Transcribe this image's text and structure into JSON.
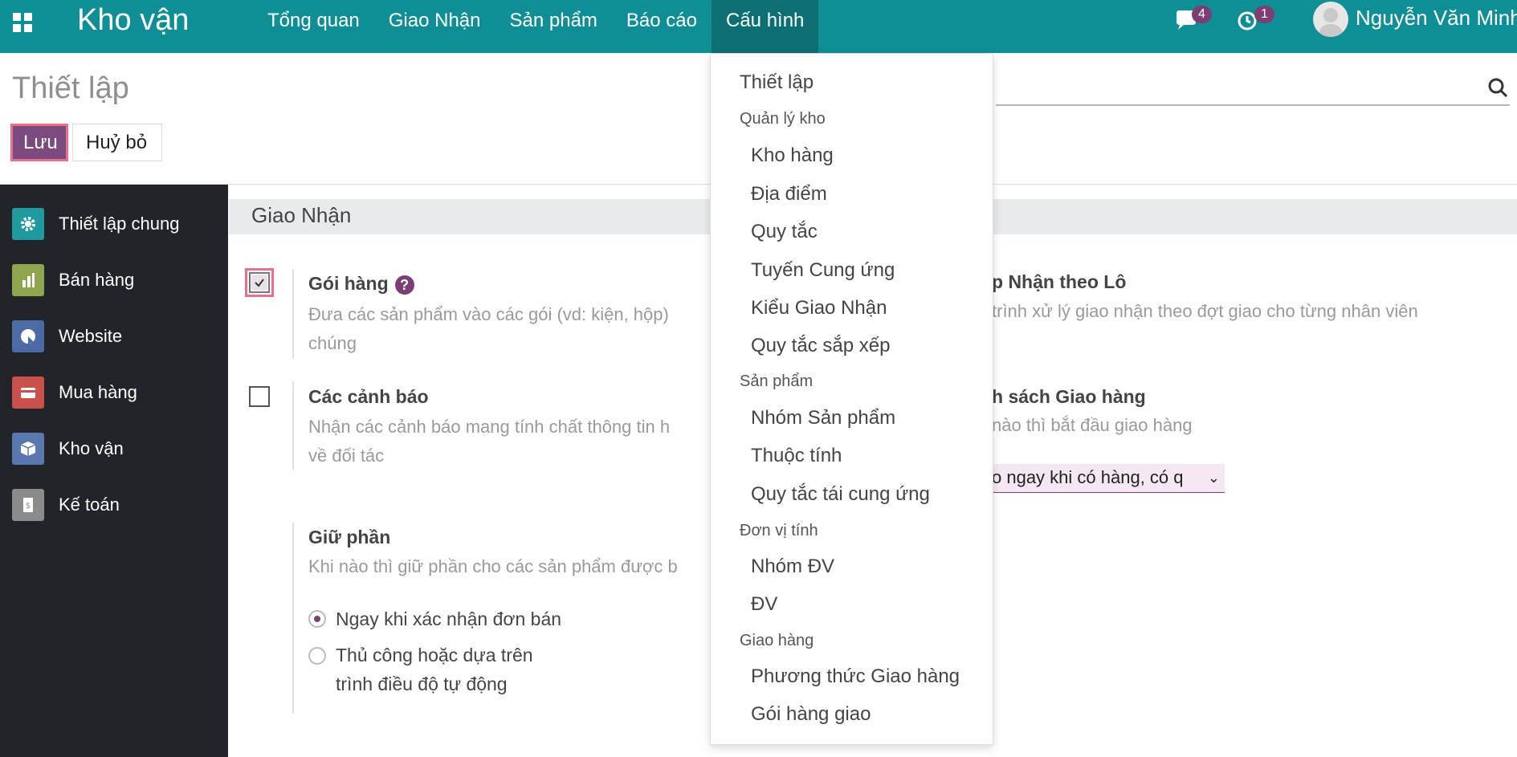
{
  "navbar": {
    "app_name": "Kho vận",
    "menu": [
      "Tổng quan",
      "Giao Nhận",
      "Sản phẩm",
      "Báo cáo",
      "Cấu hình"
    ],
    "active_menu": "Cấu hình",
    "chat_count": "4",
    "activity_count": "1",
    "user_name": "Nguyễn Văn Minh"
  },
  "control": {
    "title": "Thiết lập",
    "save_label": "Lưu",
    "cancel_label": "Huỷ bỏ"
  },
  "sidebar": {
    "items": [
      {
        "label": "Thiết lập chung",
        "icon": "gear-icon",
        "color": "#1e9aa0"
      },
      {
        "label": "Bán hàng",
        "icon": "sales-icon",
        "color": "#8fa64e"
      },
      {
        "label": "Website",
        "icon": "website-icon",
        "color": "#4c6ba5"
      },
      {
        "label": "Mua hàng",
        "icon": "purchase-icon",
        "color": "#c9514a"
      },
      {
        "label": "Kho vận",
        "icon": "inventory-icon",
        "color": "#5b77b0"
      },
      {
        "label": "Kế toán",
        "icon": "accounting-icon",
        "color": "#8b8b8b"
      }
    ]
  },
  "main": {
    "section_title": "Giao Nhận",
    "packages": {
      "title": "Gói hàng",
      "desc_line1": "Đưa các sản phẩm vào các gói (vd: kiện, hộp)",
      "desc_line2": "chúng"
    },
    "warnings": {
      "title": "Các cảnh báo",
      "desc_line1": "Nhận các cảnh báo mang tính chất thông tin h",
      "desc_line2": "về đối tác"
    },
    "reservation": {
      "title": "Giữ phần",
      "desc": "Khi nào thì giữ phần cho các sản phẩm được b",
      "option1": "Ngay khi xác nhận đơn bán",
      "option2_line1": "Thủ công hoặc dựa trên",
      "option2_line2": "trình điều độ tự động"
    },
    "batch": {
      "title": "p Nhận theo Lô",
      "desc": "trình xử lý giao nhận theo đợt giao cho từng nhân viên"
    },
    "shipping_policy": {
      "title": "h sách Giao hàng",
      "desc": "nào thì bắt đầu giao hàng",
      "select_value": "o ngay khi có hàng, có q"
    }
  },
  "dropdown": {
    "settings": "Thiết lập",
    "header_warehouse": "Quản lý kho",
    "warehouses": "Kho hàng",
    "locations": "Địa điểm",
    "rules": "Quy tắc",
    "routes": "Tuyến Cung ứng",
    "operation_types": "Kiểu Giao Nhận",
    "putaway_rules": "Quy tắc sắp xếp",
    "header_products": "Sản phẩm",
    "product_categories": "Nhóm Sản phẩm",
    "attributes": "Thuộc tính",
    "reordering_rules": "Quy tắc tái cung ứng",
    "header_uom": "Đơn vị tính",
    "uom_categories": "Nhóm ĐV",
    "uom": "ĐV",
    "header_delivery": "Giao hàng",
    "shipping_methods": "Phương thức Giao hàng",
    "delivery_packages": "Gói hàng giao"
  }
}
